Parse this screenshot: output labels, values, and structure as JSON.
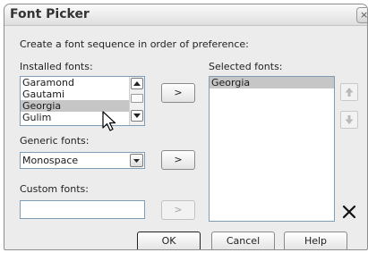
{
  "window": {
    "title": "Font Picker",
    "close_glyph": "×"
  },
  "instruction": "Create a font sequence in order of preference:",
  "installed": {
    "label": "Installed fonts:",
    "items": [
      "Garamond",
      "Gautami",
      "Georgia",
      "Gulim"
    ],
    "selected": "Georgia",
    "add_label": ">"
  },
  "selected_fonts": {
    "label": "Selected fonts:",
    "items": [
      "Georgia"
    ]
  },
  "generic": {
    "label": "Generic fonts:",
    "value": "Monospace",
    "add_label": ">"
  },
  "custom": {
    "label": "Custom fonts:",
    "value": "",
    "add_label": ">"
  },
  "footer": {
    "ok": "OK",
    "cancel": "Cancel",
    "help": "Help"
  },
  "icons": [
    "close-icon",
    "scroll-up-arrow-icon",
    "scroll-down-arrow-icon",
    "move-up-icon",
    "move-down-icon",
    "delete-x-icon",
    "mouse-pointer-icon",
    "dropdown-arrow-icon"
  ],
  "colors": {
    "selection": "#c6c6c6",
    "dialog_bg": "#ececec",
    "field_border": "#7f9db9"
  }
}
